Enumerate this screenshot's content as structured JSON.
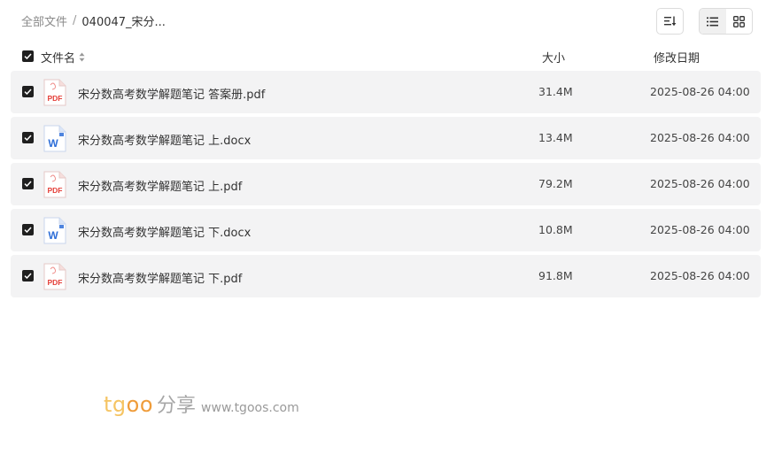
{
  "breadcrumb": {
    "root": "全部文件",
    "separator": "/",
    "current": "040047_宋分..."
  },
  "toolbar": {
    "sort_icon": "sort-icon",
    "list_view_icon": "list-view-icon",
    "grid_view_icon": "grid-view-icon",
    "active_view": "list"
  },
  "table": {
    "columns": {
      "name": "文件名",
      "size": "大小",
      "date": "修改日期"
    },
    "rows": [
      {
        "name": "宋分数高考数学解题笔记 答案册.pdf",
        "type": "pdf",
        "icon_label": "PDF",
        "size": "31.4M",
        "date": "2025-08-26 04:00",
        "checked": true
      },
      {
        "name": "宋分数高考数学解题笔记 上.docx",
        "type": "docx",
        "icon_label": "W",
        "size": "13.4M",
        "date": "2025-08-26 04:00",
        "checked": true
      },
      {
        "name": "宋分数高考数学解题笔记 上.pdf",
        "type": "pdf",
        "icon_label": "PDF",
        "size": "79.2M",
        "date": "2025-08-26 04:00",
        "checked": true
      },
      {
        "name": "宋分数高考数学解题笔记 下.docx",
        "type": "docx",
        "icon_label": "W",
        "size": "10.8M",
        "date": "2025-08-26 04:00",
        "checked": true
      },
      {
        "name": "宋分数高考数学解题笔记 下.pdf",
        "type": "pdf",
        "icon_label": "PDF",
        "size": "91.8M",
        "date": "2025-08-26 04:00",
        "checked": true
      }
    ]
  },
  "watermark": {
    "logo_part1": "tg",
    "logo_part2": "oo",
    "chinese": "分享",
    "url": "www.tgoos.com"
  },
  "colors": {
    "row_background": "#f3f3f4",
    "pdf_red": "#e5403a",
    "word_blue": "#2f6fd8",
    "checkbox": "#1f1f1f"
  }
}
